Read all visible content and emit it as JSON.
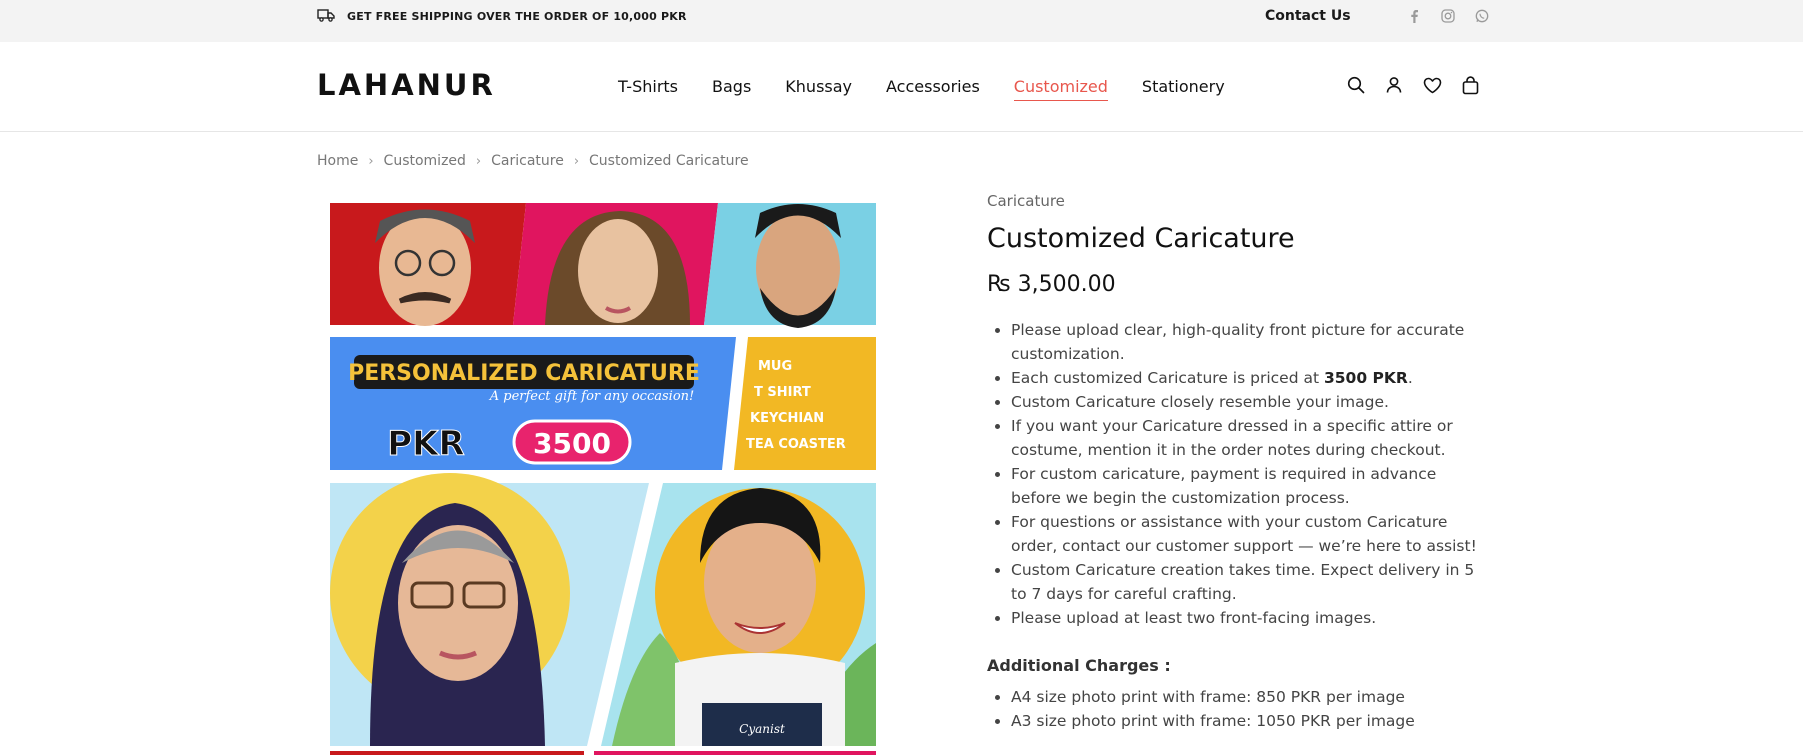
{
  "topbar": {
    "shipping_text": "GET FREE SHIPPING OVER THE ORDER OF 10,000 PKR",
    "contact_label": "Contact Us",
    "icons": [
      "truck-icon",
      "facebook-icon",
      "instagram-icon",
      "whatsapp-icon"
    ]
  },
  "header": {
    "logo_text": "LAHANUR",
    "nav": [
      "T-Shirts",
      "Bags",
      "Khussay",
      "Accessories",
      "Customized",
      "Stationery"
    ],
    "active_nav": "Customized",
    "icons": [
      "search-icon",
      "account-icon",
      "wishlist-heart-icon",
      "cart-bag-icon"
    ]
  },
  "breadcrumb": [
    "Home",
    "Customized",
    "Caricature",
    "Customized Caricature"
  ],
  "gallery": {
    "banner_title": "PERSONALIZED CARICATURE",
    "banner_subtitle": "A perfect gift for any occasion!",
    "banner_price_prefix": "PKR",
    "banner_price": "3500",
    "banner_items": [
      "MUG",
      "T SHIRT",
      "KEYCHIAN",
      "TEA COASTER"
    ],
    "shirt_signature": "Cyanist"
  },
  "product": {
    "category": "Caricature",
    "title": "Customized Caricature",
    "price": "₨ 3,500.00",
    "features": [
      "Please upload clear, high-quality front picture for accurate customization.",
      "Each customized Caricature is priced at ",
      "Custom Caricature closely resemble your image.",
      "If you want your Caricature dressed in a specific attire or costume, mention it in the order notes during checkout.",
      "For custom caricature, payment is required in advance before we begin the customization process.",
      "For questions or assistance with your custom Caricature order, contact our customer support — we’re here to assist!",
      "Custom Caricature creation takes time. Expect delivery in 5 to 7 days for careful crafting.",
      "Please upload at least two front-facing images."
    ],
    "feature_price_bold": "3500 PKR",
    "feature_price_suffix": ".",
    "additional_heading": "Additional Charges :",
    "charges": [
      "A4 size photo print with frame: 850 PKR per image",
      "A3 size photo print with frame: 1050 PKR per image"
    ]
  },
  "colors": {
    "accent": "#e8574d",
    "banner_blue": "#3b82e8",
    "banner_yellow": "#f2b824",
    "banner_pink": "#e8236d"
  }
}
